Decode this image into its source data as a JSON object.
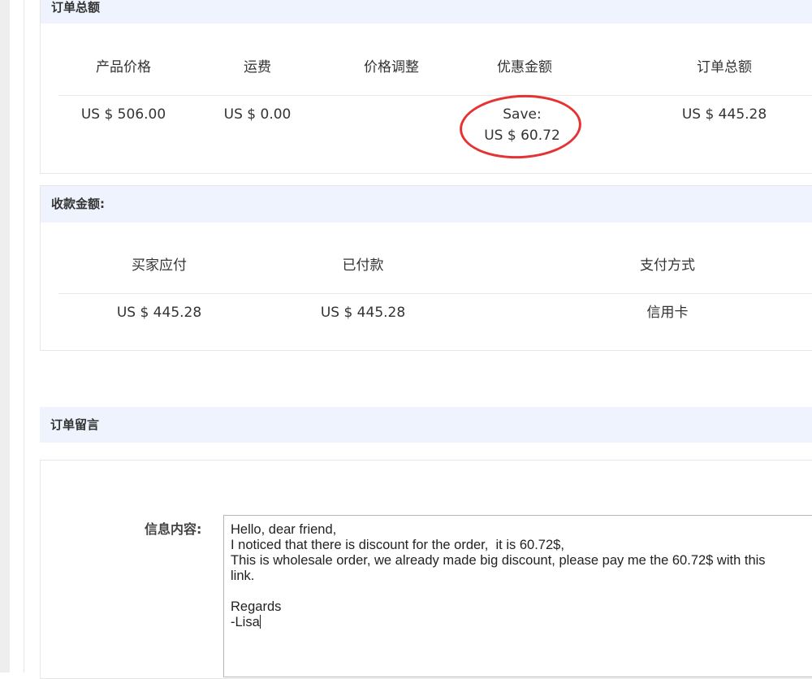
{
  "order_total": {
    "title": "订单总额",
    "headers": [
      "产品价格",
      "运费",
      "价格调整",
      "优惠金额",
      "订单总额"
    ],
    "product_price": "US $ 506.00",
    "shipping": "US $ 0.00",
    "price_adjustment": "",
    "discount_label": "Save:",
    "discount_value": "US $ 60.72",
    "order_amount": "US $ 445.28"
  },
  "payment": {
    "title": "收款金额:",
    "headers": [
      "买家应付",
      "已付款",
      "支付方式"
    ],
    "buyer_due": "US $ 445.28",
    "paid": "US $ 445.28",
    "method": "信用卡"
  },
  "order_message": {
    "title": "订单留言",
    "label": "信息内容:",
    "lines": [
      "Hello, dear friend,",
      "I noticed that there is discount for the order,  it is 60.72$,",
      "This is wholesale order, we already made big discount, please pay me the 60.72$ with this",
      "link.",
      "",
      "Regards",
      "-Lisa"
    ]
  },
  "colors": {
    "header_bg": "#eef3fd",
    "annotation_circle": "#e53333"
  }
}
